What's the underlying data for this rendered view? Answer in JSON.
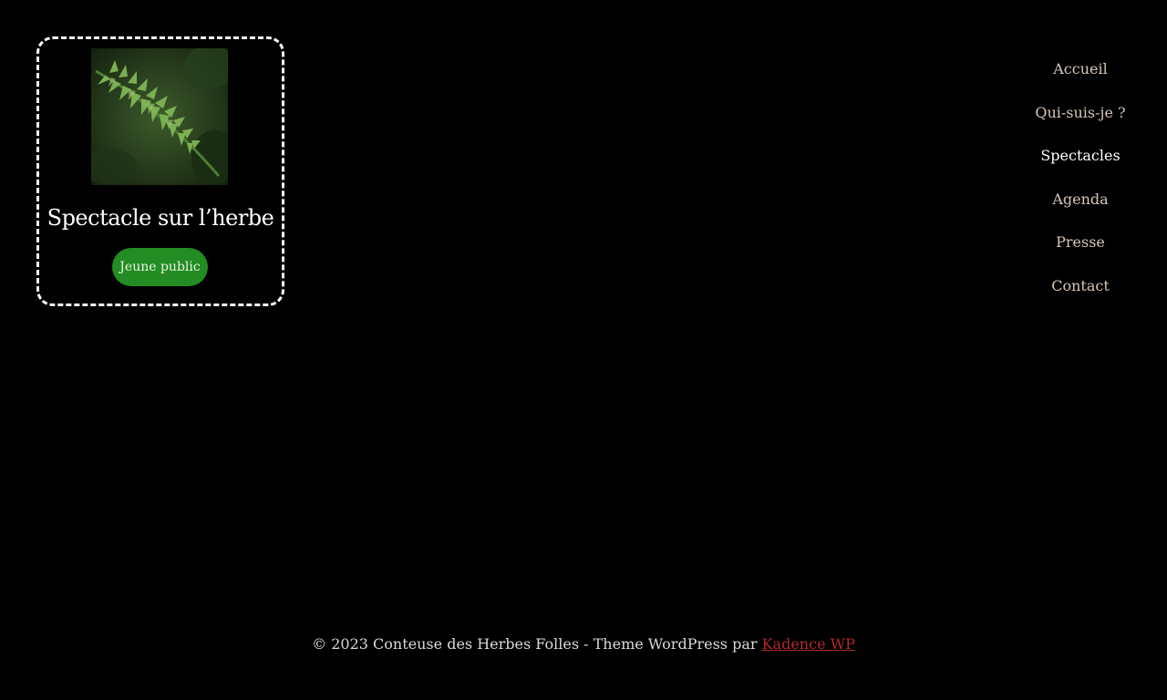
{
  "card": {
    "title": "Spectacle sur l’herbe",
    "badge": "Jeune public",
    "image_name": "fern-image"
  },
  "nav": {
    "items": [
      {
        "label": "Accueil",
        "active": false
      },
      {
        "label": "Qui-suis-je ?",
        "active": false
      },
      {
        "label": "Spectacles",
        "active": true
      },
      {
        "label": "Agenda",
        "active": false
      },
      {
        "label": "Presse",
        "active": false
      },
      {
        "label": "Contact",
        "active": false
      }
    ]
  },
  "footer": {
    "text": "© 2023 Conteuse des Herbes Folles - Theme WordPress par ",
    "link_label": "Kadence WP"
  },
  "colors": {
    "background": "#000000",
    "badge": "#238c23",
    "nav_text": "#d6c6b8",
    "nav_active": "#ffffff",
    "footer_link": "#b02a2a"
  }
}
